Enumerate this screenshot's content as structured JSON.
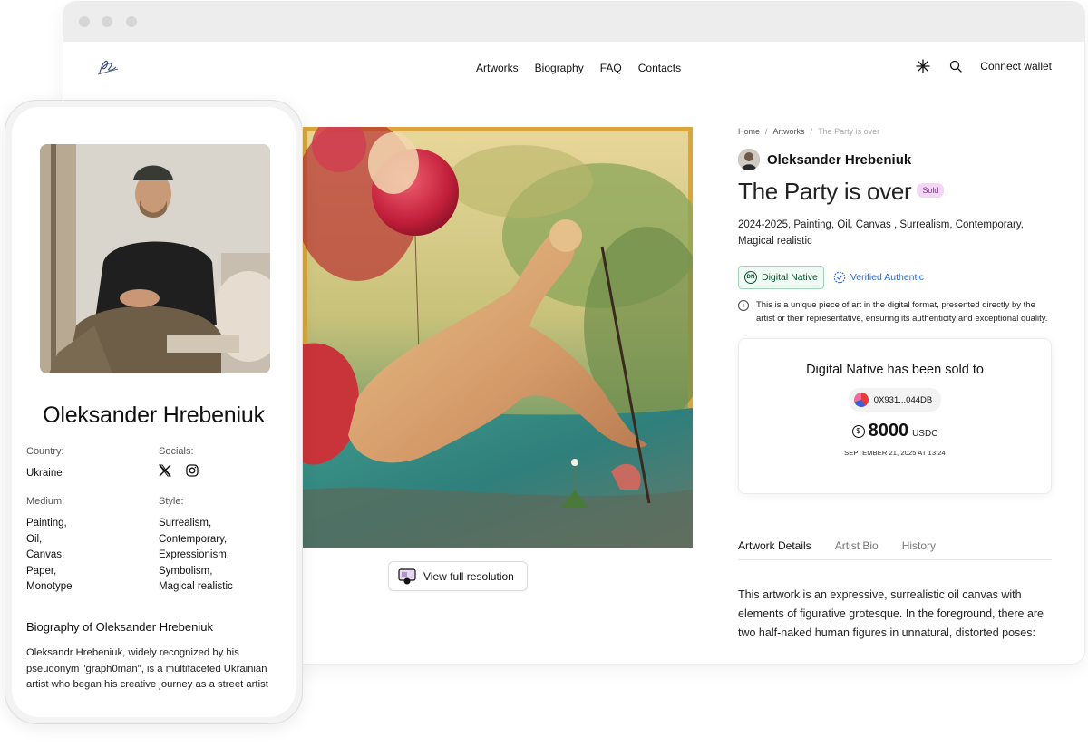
{
  "header": {
    "nav": [
      "Artworks",
      "Biography",
      "FAQ",
      "Contacts"
    ],
    "connect_label": "Connect wallet"
  },
  "breadcrumb": [
    "Home",
    "Artworks",
    "The Party is over"
  ],
  "artist": {
    "name": "Oleksander Hrebeniuk"
  },
  "artwork": {
    "title": "The Party is over",
    "status": "Sold",
    "meta": "2024-2025, Painting, Oil, Canvas , Surrealism, Contemporary, Magical realistic",
    "badge_native": "Digital Native",
    "badge_native_short": "DN",
    "badge_verified": "Verified Authentic",
    "info": "This is a unique piece of art in the digital format, presented directly by the artist or their representative, ensuring its authenticity and exceptional quality.",
    "view_label": "View full resolution"
  },
  "sale": {
    "title": "Digital Native has been sold to",
    "wallet": "0X931...044DB",
    "price": "8000",
    "currency": "USDC",
    "date": "SEPTEMBER 21, 2025 AT 13:24"
  },
  "tabs": [
    "Artwork Details",
    "Artist Bio",
    "History"
  ],
  "description": "This artwork is an expressive, surrealistic oil canvas with elements of figurative grotesque. In the foreground, there are two half-naked human figures in unnatural, distorted poses:",
  "phone": {
    "name": "Oleksander Hrebeniuk",
    "country_label": "Country:",
    "country": "Ukraine",
    "socials_label": "Socials:",
    "medium_label": "Medium:",
    "medium": [
      "Painting,",
      "Oil,",
      "Canvas,",
      "Paper,",
      "Monotype"
    ],
    "style_label": "Style:",
    "style": [
      "Surrealism,",
      "Contemporary,",
      "Expressionism,",
      "Symbolism,",
      "Magical realistic"
    ],
    "bio_title": "Biography of Oleksander Hrebeniuk",
    "bio": "Oleksandr Hrebeniuk, widely recognized by his pseudonym \"graph0man\", is a multifaceted Ukrainian artist who began his creative journey as a street artist"
  },
  "icons": {
    "theme": "sun-icon",
    "search": "search-icon",
    "x": "x-social-icon",
    "instagram": "instagram-icon"
  }
}
